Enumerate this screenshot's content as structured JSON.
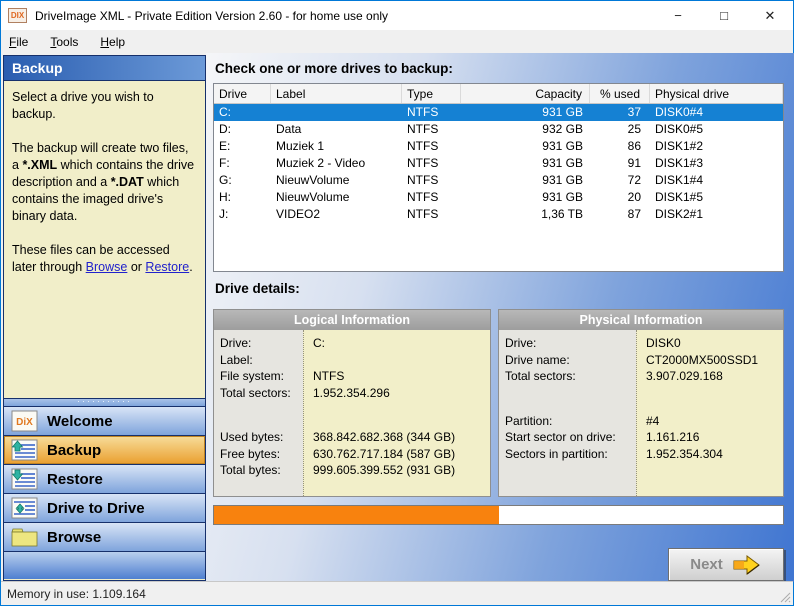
{
  "window": {
    "title": "DriveImage XML - Private Edition Version 2.60 - for home use only",
    "app_icon_text": "DIX",
    "controls": {
      "minimize": "−",
      "maximize": "□",
      "close": "✕"
    }
  },
  "menu": {
    "items": [
      "File",
      "Tools",
      "Help"
    ]
  },
  "sidebar": {
    "header": "Backup",
    "description": {
      "p1": "Select a drive you wish to backup.",
      "p2_a": "The backup will create two files, a ",
      "p2_xml": "*.XML",
      "p2_b": " which contains the drive description and a ",
      "p2_dat": "*.DAT",
      "p2_c": " which contains the imaged drive's binary data.",
      "p3_a": "These files can be accessed later through ",
      "p3_browse": "Browse",
      "p3_or": " or ",
      "p3_restore": "Restore",
      "p3_dot": "."
    },
    "nav": {
      "items": [
        {
          "label": "Welcome",
          "icon": "dix-logo",
          "active": false
        },
        {
          "label": "Backup",
          "icon": "list-arrow-up",
          "active": true
        },
        {
          "label": "Restore",
          "icon": "list-arrow-down",
          "active": false
        },
        {
          "label": "Drive to Drive",
          "icon": "list-arrow-updown",
          "active": false
        },
        {
          "label": "Browse",
          "icon": "folder",
          "active": false
        }
      ],
      "welcome_icon_text": "DiX"
    }
  },
  "main": {
    "drives_heading": "Check one or more drives to backup:",
    "drive_table": {
      "columns": [
        {
          "label": "Drive"
        },
        {
          "label": "Label"
        },
        {
          "label": "Type"
        },
        {
          "label": "Capacity"
        },
        {
          "label": "% used"
        },
        {
          "label": "Physical drive"
        }
      ],
      "rows": [
        {
          "cells": [
            "C:",
            "",
            "NTFS",
            "931 GB",
            "37",
            "DISK0#4"
          ],
          "selected": true
        },
        {
          "cells": [
            "D:",
            "Data",
            "NTFS",
            "932 GB",
            "25",
            "DISK0#5"
          ],
          "selected": false
        },
        {
          "cells": [
            "E:",
            "Muziek 1",
            "NTFS",
            "931 GB",
            "86",
            "DISK1#2"
          ],
          "selected": false
        },
        {
          "cells": [
            "F:",
            "Muziek 2 - Video",
            "NTFS",
            "931 GB",
            "91",
            "DISK1#3"
          ],
          "selected": false
        },
        {
          "cells": [
            "G:",
            "NieuwVolume",
            "NTFS",
            "931 GB",
            "72",
            "DISK1#4"
          ],
          "selected": false
        },
        {
          "cells": [
            "H:",
            "NieuwVolume",
            "NTFS",
            "931 GB",
            "20",
            "DISK1#5"
          ],
          "selected": false
        },
        {
          "cells": [
            "J:",
            "VIDEO2",
            "NTFS",
            "1,36 TB",
            "87",
            "DISK2#1"
          ],
          "selected": false
        }
      ]
    },
    "details_heading": "Drive details:",
    "logical_panel": {
      "title": "Logical Information",
      "rows": [
        [
          "Drive:",
          "C:"
        ],
        [
          "Label:",
          ""
        ],
        [
          "File system:",
          "NTFS"
        ],
        [
          "Total sectors:",
          "1.952.354.296"
        ],
        [
          "",
          ""
        ],
        [
          "Used bytes:",
          "368.842.682.368 (344 GB)"
        ],
        [
          "Free bytes:",
          "630.762.717.184 (587 GB)"
        ],
        [
          "Total bytes:",
          "999.605.399.552 (931 GB)"
        ]
      ]
    },
    "physical_panel": {
      "title": "Physical Information",
      "rows": [
        [
          "Drive:",
          "DISK0"
        ],
        [
          "Drive name:",
          "CT2000MX500SSD1"
        ],
        [
          "Total sectors:",
          "3.907.029.168"
        ],
        [
          "",
          ""
        ],
        [
          "Partition:",
          "#4"
        ],
        [
          "Start sector on drive:",
          "1.161.216"
        ],
        [
          "Sectors in partition:",
          "1.952.354.304"
        ]
      ]
    },
    "progress": {
      "percent": 50
    },
    "next_button": {
      "label": "Next",
      "icon": "arrow-right"
    }
  },
  "status_bar": {
    "text": "Memory in use: 1.109.164"
  },
  "colors": {
    "selection_blue": "#1581D3",
    "progress_orange": "#F8820E",
    "active_item_orange": "#EA9F2F",
    "link_blue": "#2222CC",
    "window_border_blue": "#0078D7",
    "panel_cream": "#F2EFC9"
  }
}
